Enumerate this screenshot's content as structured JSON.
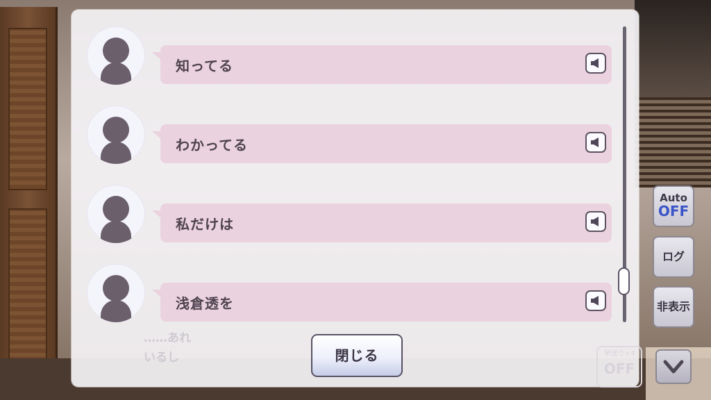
{
  "log": {
    "entries": [
      {
        "text": "知ってる"
      },
      {
        "text": "わかってる"
      },
      {
        "text": "私だけは"
      },
      {
        "text": "浅倉透を"
      }
    ],
    "close_label": "閉じる",
    "background_text": [
      "……あれ",
      "いるし"
    ],
    "background_badge": {
      "top": "早送り×4",
      "bottom": "OFF"
    }
  },
  "side": {
    "auto_label": "Auto",
    "auto_state": "OFF",
    "log_label": "ログ",
    "hide_label": "非表示"
  },
  "icons": {
    "voice": "speaker-icon",
    "down": "chevron-down-icon"
  },
  "colors": {
    "bubble": "#ebd2df",
    "auto_off": "#3a55c8"
  }
}
